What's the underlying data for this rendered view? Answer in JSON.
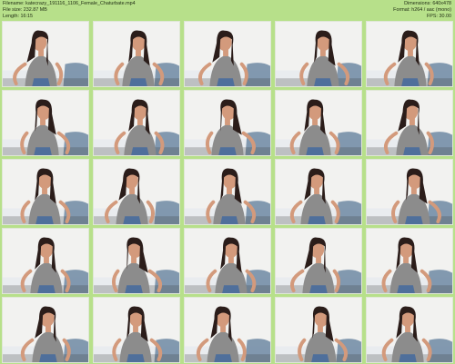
{
  "header": {
    "filename": "Filename: katecrazy_191116_1106_Female_Chaturbate.mp4",
    "filesize": "File size: 232.87 MB",
    "length": "Length: 16:15",
    "dimensions": "Dimensions: 640x478",
    "format": "Format: h264 / aac (mono)",
    "fps": "FPS: 30.00"
  },
  "colors": {
    "sheet_background": "#b7e08a",
    "wall": "#f2f2f0",
    "top_knit": "#8c8c8c",
    "hair": "#2b1d1a",
    "skin": "#d39a7c",
    "denim": "#4f6f9b",
    "pillow": "#6f8aa3"
  },
  "thumbnails": [
    {
      "id": 1,
      "time": ""
    },
    {
      "id": 2,
      "time": ""
    },
    {
      "id": 3,
      "time": ""
    },
    {
      "id": 4,
      "time": ""
    },
    {
      "id": 5,
      "time": ""
    },
    {
      "id": 6,
      "time": ""
    },
    {
      "id": 7,
      "time": ""
    },
    {
      "id": 8,
      "time": ""
    },
    {
      "id": 9,
      "time": ""
    },
    {
      "id": 10,
      "time": ""
    },
    {
      "id": 11,
      "time": ""
    },
    {
      "id": 12,
      "time": ""
    },
    {
      "id": 13,
      "time": ""
    },
    {
      "id": 14,
      "time": ""
    },
    {
      "id": 15,
      "time": ""
    },
    {
      "id": 16,
      "time": ""
    },
    {
      "id": 17,
      "time": ""
    },
    {
      "id": 18,
      "time": ""
    },
    {
      "id": 19,
      "time": ""
    },
    {
      "id": 20,
      "time": ""
    },
    {
      "id": 21,
      "time": ""
    },
    {
      "id": 22,
      "time": ""
    },
    {
      "id": 23,
      "time": ""
    },
    {
      "id": 24,
      "time": ""
    },
    {
      "id": 25,
      "time": ""
    }
  ]
}
